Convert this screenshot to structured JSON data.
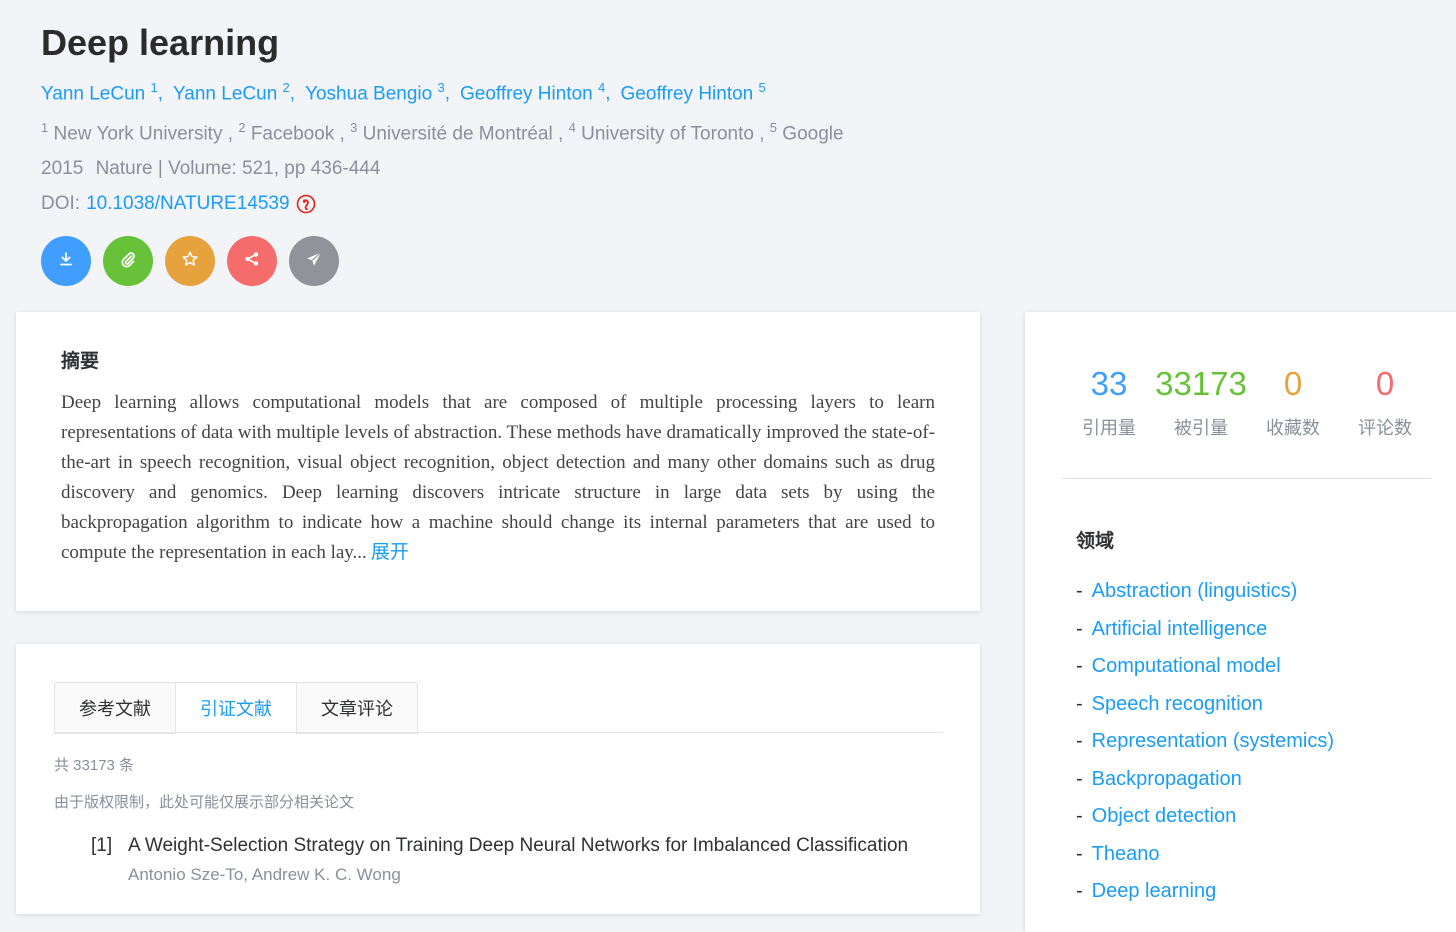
{
  "paper": {
    "title": "Deep learning",
    "authors": [
      {
        "name": "Yann LeCun",
        "sup": "1"
      },
      {
        "name": "Yann LeCun",
        "sup": "2"
      },
      {
        "name": "Yoshua Bengio",
        "sup": "3"
      },
      {
        "name": "Geoffrey Hinton",
        "sup": "4"
      },
      {
        "name": "Geoffrey Hinton",
        "sup": "5"
      }
    ],
    "author_separator": ",",
    "affiliations": [
      {
        "sup": "1",
        "name": "New York University"
      },
      {
        "sup": "2",
        "name": "Facebook"
      },
      {
        "sup": "3",
        "name": "Université de Montréal"
      },
      {
        "sup": "4",
        "name": "University of Toronto"
      },
      {
        "sup": "5",
        "name": "Google"
      }
    ],
    "affiliation_separator": " , ",
    "year": "2015",
    "venue": "Nature | Volume: 521, pp 436-444",
    "doi_label": "DOI:",
    "doi": "10.1038/NATURE14539"
  },
  "actions": [
    {
      "name": "download-button",
      "icon": "download-icon",
      "color": "#409eff"
    },
    {
      "name": "attachment-button",
      "icon": "paperclip-icon",
      "color": "#67c23a"
    },
    {
      "name": "favorite-button",
      "icon": "star-icon",
      "color": "#e6a23c"
    },
    {
      "name": "share-button",
      "icon": "share-icon",
      "color": "#f56c6c"
    },
    {
      "name": "send-button",
      "icon": "paper-plane-icon",
      "color": "#909399"
    }
  ],
  "abstract": {
    "heading": "摘要",
    "text": "Deep learning allows computational models that are composed of multiple processing layers to learn representations of data with multiple levels of abstraction. These methods have dramatically improved the state-of-the-art in speech recognition, visual object recognition, object detection and many other domains such as drug discovery and genomics. Deep learning discovers intricate structure in large data sets by using the backpropagation algorithm to indicate how a machine should change its internal parameters that are used to compute the representation in each lay...",
    "expand_label": "展开"
  },
  "tabs": [
    {
      "label": "参考文献",
      "active": false
    },
    {
      "label": "引证文献",
      "active": true
    },
    {
      "label": "文章评论",
      "active": false
    }
  ],
  "citations": {
    "total_text": "共 33173 条",
    "notice": "由于版权限制，此处可能仅展示部分相关论文",
    "items": [
      {
        "num": "[1]",
        "title": "A Weight-Selection Strategy on Training Deep Neural Networks for Imbalanced Classification",
        "authors": "Antonio Sze-To, Andrew K. C. Wong"
      }
    ]
  },
  "stats": [
    {
      "value": "33",
      "label": "引用量",
      "color": "#409eff"
    },
    {
      "value": "33173",
      "label": "被引量",
      "color": "#67c23a"
    },
    {
      "value": "0",
      "label": "收藏数",
      "color": "#e6a23c"
    },
    {
      "value": "0",
      "label": "评论数",
      "color": "#f56c6c"
    }
  ],
  "fields": {
    "heading": "领域",
    "items": [
      "Abstraction (linguistics)",
      "Artificial intelligence",
      "Computational model",
      "Speech recognition",
      "Representation (systemics)",
      "Backpropagation",
      "Object detection",
      "Theano",
      "Deep learning"
    ]
  }
}
